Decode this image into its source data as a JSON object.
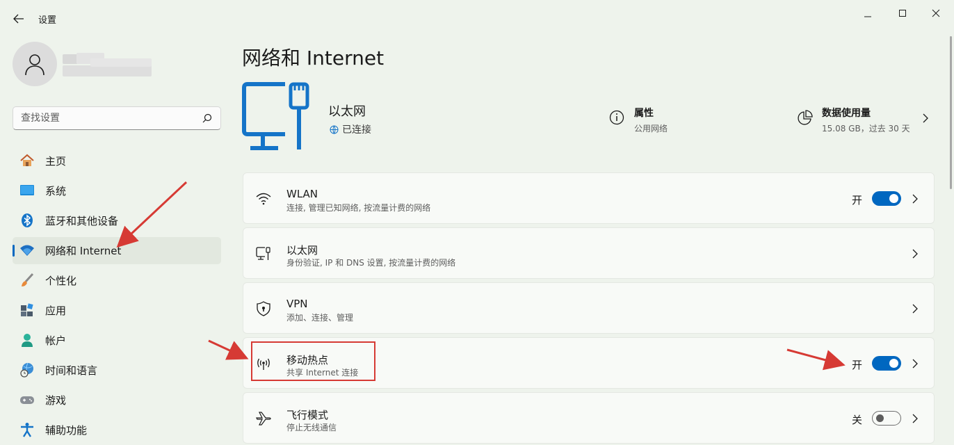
{
  "window": {
    "title": "设置",
    "back_icon": "arrow-left-icon",
    "minimize_icon": "minimize-icon",
    "maximize_icon": "maximize-icon",
    "close_icon": "close-icon"
  },
  "sidebar": {
    "search": {
      "placeholder": "查找设置",
      "value": ""
    },
    "items": [
      {
        "label": "主页",
        "icon": "home-icon",
        "active": false
      },
      {
        "label": "系统",
        "icon": "system-icon",
        "active": false
      },
      {
        "label": "蓝牙和其他设备",
        "icon": "bluetooth-icon",
        "active": false
      },
      {
        "label": "网络和 Internet",
        "icon": "wifi-icon",
        "active": true
      },
      {
        "label": "个性化",
        "icon": "brush-icon",
        "active": false
      },
      {
        "label": "应用",
        "icon": "apps-icon",
        "active": false
      },
      {
        "label": "帐户",
        "icon": "account-icon",
        "active": false
      },
      {
        "label": "时间和语言",
        "icon": "globe-clock-icon",
        "active": false
      },
      {
        "label": "游戏",
        "icon": "gamepad-icon",
        "active": false
      },
      {
        "label": "辅助功能",
        "icon": "accessibility-icon",
        "active": false
      }
    ]
  },
  "main": {
    "title": "网络和 Internet",
    "hero": {
      "name": "以太网",
      "status": "已连接",
      "properties": {
        "title": "属性",
        "subtitle": "公用网络"
      },
      "data_usage": {
        "title": "数据使用量",
        "subtitle": "15.08 GB，过去 30 天"
      }
    },
    "cards": [
      {
        "title": "WLAN",
        "subtitle": "连接, 管理已知网络, 按流量计费的网络",
        "icon": "wifi-icon",
        "toggle_label": "开",
        "toggle_on": true
      },
      {
        "title": "以太网",
        "subtitle": "身份验证, IP 和 DNS 设置, 按流量计费的网络",
        "icon": "ethernet-icon"
      },
      {
        "title": "VPN",
        "subtitle": "添加、连接、管理",
        "icon": "shield-icon"
      },
      {
        "title": "移动热点",
        "subtitle": "共享 Internet 连接",
        "icon": "hotspot-icon",
        "toggle_label": "开",
        "toggle_on": true
      },
      {
        "title": "飞行模式",
        "subtitle": "停止无线通信",
        "icon": "airplane-icon",
        "toggle_label": "关",
        "toggle_on": false
      }
    ]
  },
  "colors": {
    "accent": "#0067c0",
    "background": "#eef3ec",
    "card": "#f8faf7",
    "annotation": "#d63a34"
  }
}
